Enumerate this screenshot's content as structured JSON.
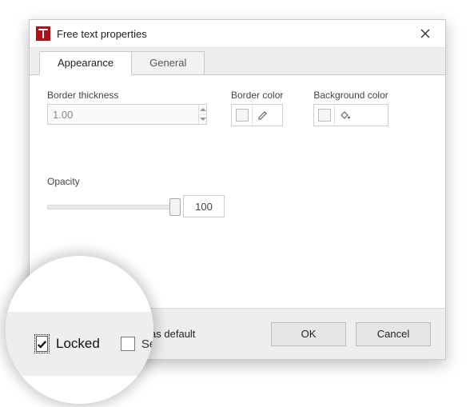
{
  "window": {
    "title": "Free text properties",
    "app_icon": "adobe-icon",
    "close_icon": "close-icon"
  },
  "tabs": [
    {
      "label": "Appearance",
      "active": true
    },
    {
      "label": "General",
      "active": false
    }
  ],
  "appearance": {
    "border_thickness": {
      "label": "Border thickness",
      "value": "1.00",
      "disabled": true
    },
    "border_color": {
      "label": "Border color",
      "value": "#f5f5f5",
      "edit_icon": "pencil-icon"
    },
    "background_color": {
      "label": "Background color",
      "value": "#f5f5f5",
      "fill_icon": "fill-bucket-icon"
    },
    "opacity": {
      "label": "Opacity",
      "value": "100",
      "min": 0,
      "max": 100
    }
  },
  "footer": {
    "locked": {
      "label": "Locked",
      "checked": true,
      "focused": true
    },
    "set_default": {
      "label": "Set as default",
      "checked": false
    },
    "ok": "OK",
    "cancel": "Cancel"
  }
}
